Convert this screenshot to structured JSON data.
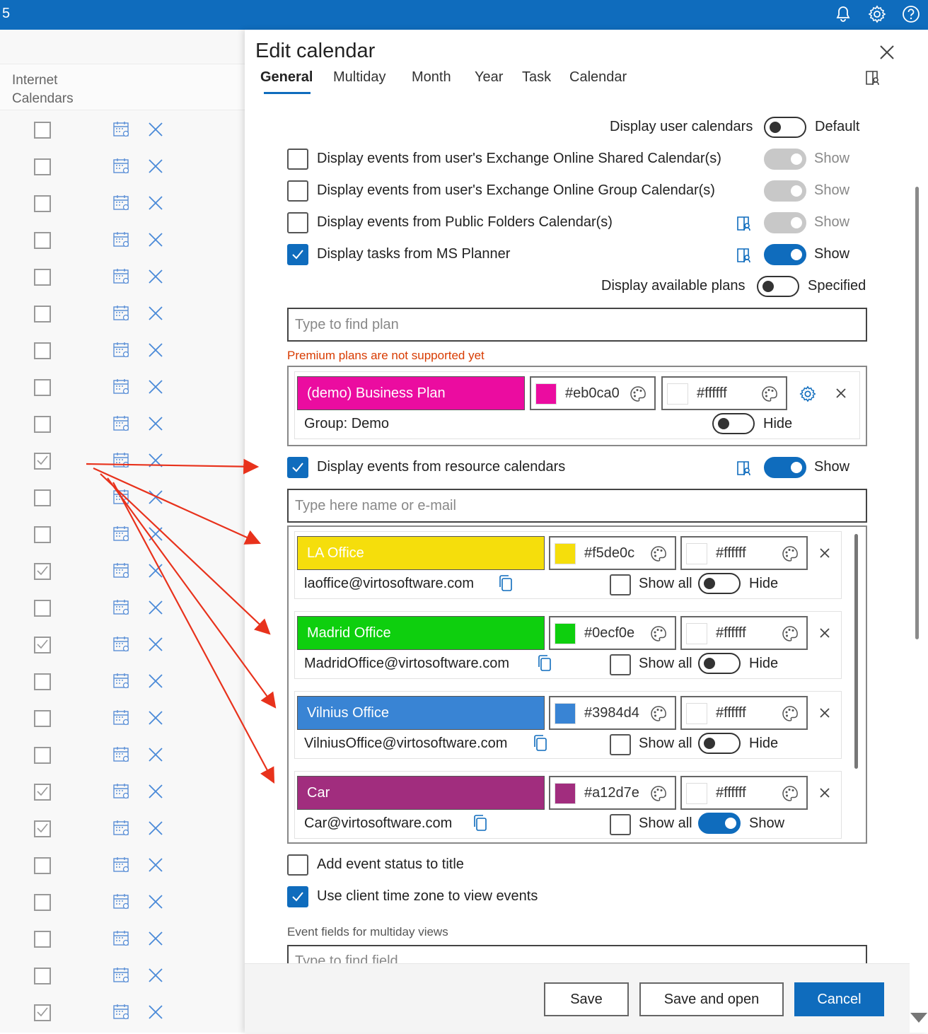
{
  "topbar": {
    "number": "5"
  },
  "left_panel": {
    "title": "Internet Calendars",
    "rows": [
      {
        "checked": false
      },
      {
        "checked": false
      },
      {
        "checked": false
      },
      {
        "checked": false
      },
      {
        "checked": false
      },
      {
        "checked": false
      },
      {
        "checked": false
      },
      {
        "checked": false
      },
      {
        "checked": false
      },
      {
        "checked": true
      },
      {
        "checked": false
      },
      {
        "checked": false
      },
      {
        "checked": true
      },
      {
        "checked": false
      },
      {
        "checked": true
      },
      {
        "checked": false
      },
      {
        "checked": false
      },
      {
        "checked": false
      },
      {
        "checked": true
      },
      {
        "checked": true
      },
      {
        "checked": false
      },
      {
        "checked": false
      },
      {
        "checked": false
      },
      {
        "checked": false
      },
      {
        "checked": true
      }
    ]
  },
  "dialog": {
    "title": "Edit calendar",
    "tabs": [
      "General",
      "Multiday",
      "Month",
      "Year",
      "Task",
      "Calendar"
    ],
    "active_tab": "General",
    "display_user_calendars": {
      "label": "Display user calendars",
      "state_label": "Default",
      "on": false
    },
    "options": [
      {
        "label": "Display events from user's Exchange Online Shared Calendar(s)",
        "checked": false,
        "toggle": "Show",
        "toggle_state": "disabled"
      },
      {
        "label": "Display events from user's Exchange Online Group Calendar(s)",
        "checked": false,
        "toggle": "Show",
        "toggle_state": "disabled"
      },
      {
        "label": "Display events from Public Folders Calendar(s)",
        "checked": false,
        "toggle": "Show",
        "toggle_state": "disabled"
      },
      {
        "label": "Display tasks from MS Planner",
        "checked": true,
        "toggle": "Show",
        "toggle_state": "on"
      }
    ],
    "display_available_plans": {
      "label": "Display available plans",
      "state_label": "Specified",
      "on": false
    },
    "plan_search": {
      "placeholder": "Type to find plan"
    },
    "premium_warning": "Premium plans are not supported yet",
    "plan": {
      "name": "(demo) Business Plan",
      "bg_color": "#eb0ca0",
      "bg_hex": "#eb0ca0",
      "text_hex": "#ffffff",
      "group": "Group: Demo",
      "toggle_label": "Hide",
      "on": false
    },
    "resource_calendars": {
      "label": "Display events from resource calendars",
      "checked": true,
      "toggle": "Show",
      "on": true
    },
    "resource_search": {
      "placeholder": "Type here name or e-mail"
    },
    "resources": [
      {
        "name": "LA Office",
        "color": "#f5de0c",
        "hex": "#f5de0c",
        "text_hex": "#ffffff",
        "email": "laoffice@virtosoftware.com",
        "show_all": "Show all",
        "toggle_label": "Hide",
        "on": false
      },
      {
        "name": "Madrid Office",
        "color": "#0ecf0e",
        "hex": "#0ecf0e",
        "text_hex": "#ffffff",
        "email": "MadridOffice@virtosoftware.com",
        "show_all": "Show all",
        "toggle_label": "Hide",
        "on": false
      },
      {
        "name": "Vilnius Office",
        "color": "#3984d4",
        "hex": "#3984d4",
        "text_hex": "#ffffff",
        "email": "VilniusOffice@virtosoftware.com",
        "show_all": "Show all",
        "toggle_label": "Hide",
        "on": false
      },
      {
        "name": "Car",
        "color": "#a12d7e",
        "hex": "#a12d7e",
        "text_hex": "#ffffff",
        "email": "Car@virtosoftware.com",
        "show_all": "Show all",
        "toggle_label": "Show",
        "on": true
      }
    ],
    "add_status": {
      "label": "Add event status to title",
      "checked": false
    },
    "client_tz": {
      "label": "Use client time zone to view events",
      "checked": true
    },
    "event_fields": {
      "label": "Event fields for multiday views",
      "placeholder": "Type to find field"
    },
    "buttons": {
      "save": "Save",
      "save_open": "Save and open",
      "cancel": "Cancel"
    }
  },
  "colors": {
    "brand": "#0f6cbd",
    "warning": "#d83b01",
    "annotation_arrow": "#e8321c"
  }
}
